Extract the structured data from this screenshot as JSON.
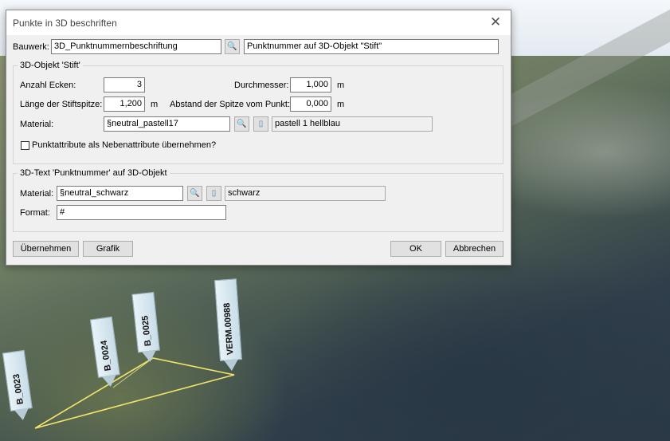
{
  "dialog": {
    "title": "Punkte in 3D beschriften",
    "close_glyph": "✕"
  },
  "bauwerk": {
    "label": "Bauwerk:",
    "value": "3D_Punktnummernbeschriftung",
    "description": "Punktnummer auf 3D-Objekt \"Stift\""
  },
  "group_stift": {
    "title": "3D-Objekt 'Stift'",
    "anzahl_ecken_label": "Anzahl Ecken:",
    "anzahl_ecken_value": "3",
    "durchmesser_label": "Durchmesser:",
    "durchmesser_value": "1,000",
    "durchmesser_unit": "m",
    "laenge_label": "Länge der Stiftspitze:",
    "laenge_value": "1,200",
    "laenge_unit": "m",
    "abstand_label": "Abstand der Spitze vom Punkt:",
    "abstand_value": "0,000",
    "abstand_unit": "m",
    "material_label": "Material:",
    "material_value": "§neutral_pastell17",
    "material_name": "pastell 1 hellblau",
    "checkbox_label": "Punktattribute als Nebenattribute übernehmen?",
    "checkbox_checked": false
  },
  "group_text": {
    "title": "3D-Text 'Punktnummer' auf 3D-Objekt",
    "material_label": "Material:",
    "material_value": "§neutral_schwarz",
    "material_name": "schwarz",
    "format_label": "Format:",
    "format_value": "#"
  },
  "buttons": {
    "uebernehmen": "Übernehmen",
    "grafik": "Grafik",
    "ok": "OK",
    "abbrechen": "Abbrechen"
  },
  "scene": {
    "pins": [
      "B_0023",
      "B_0024",
      "B_0025",
      "VERM.00988"
    ]
  }
}
